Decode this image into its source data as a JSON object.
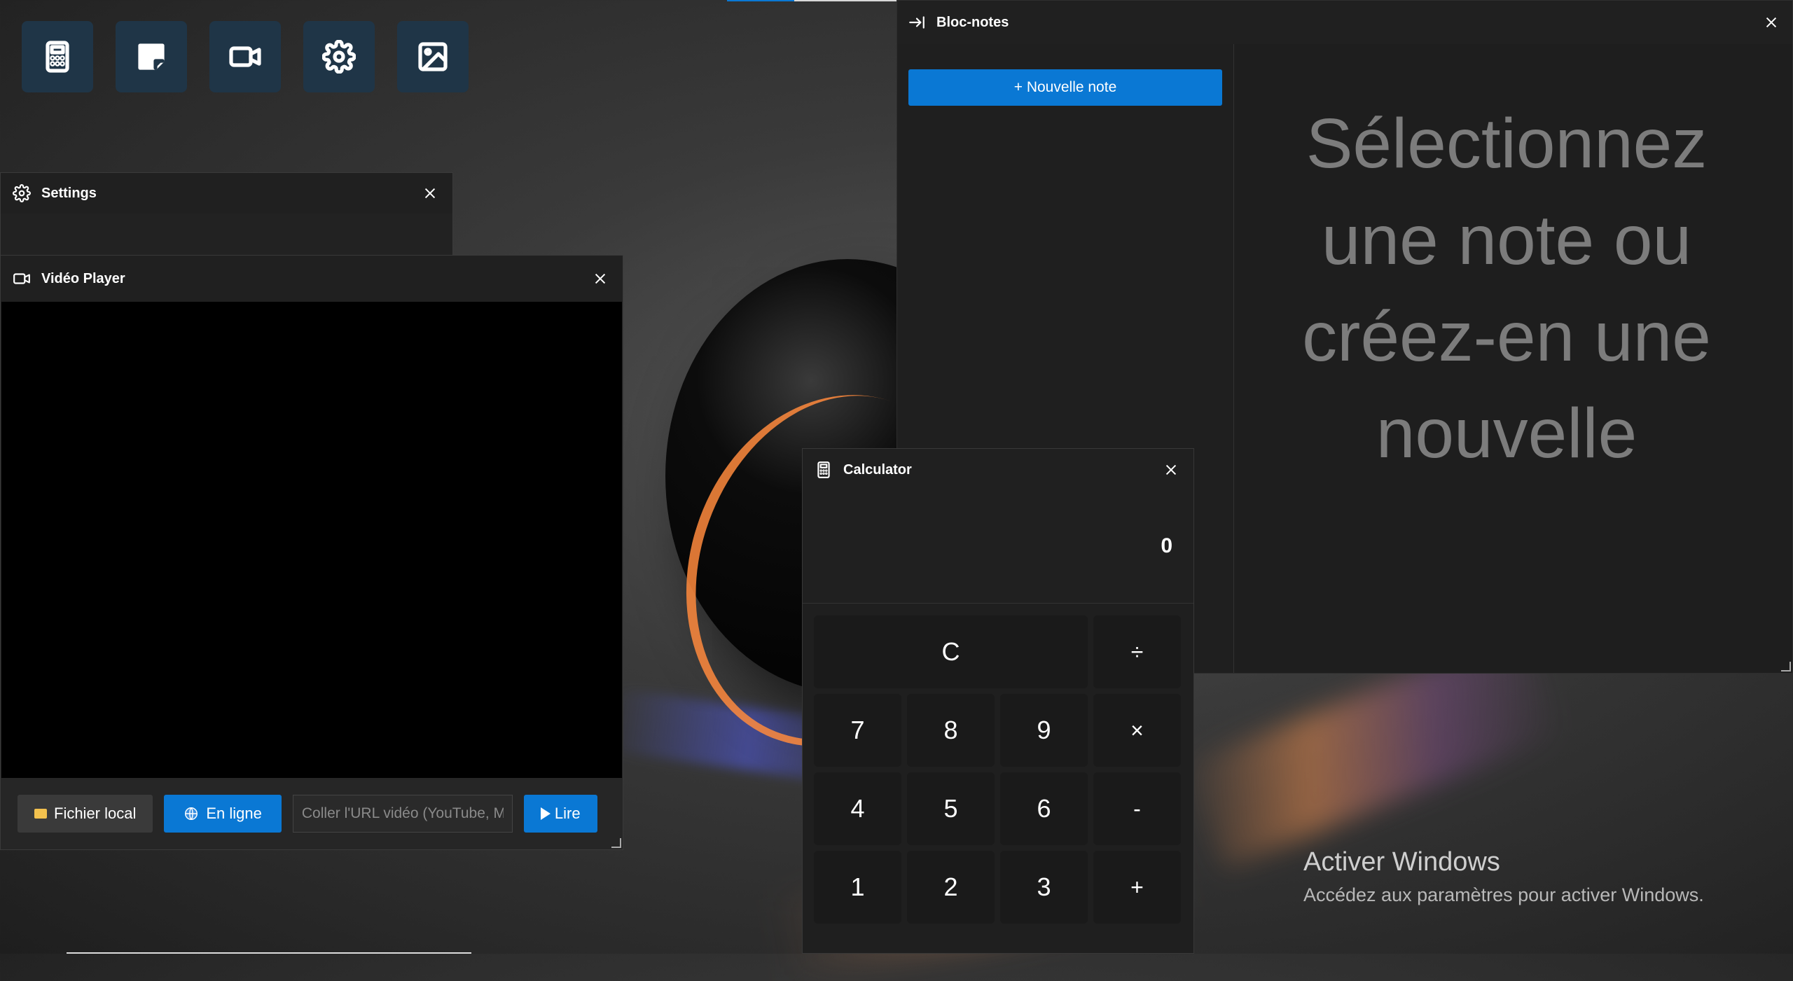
{
  "dock": {
    "items": [
      {
        "name": "calculator",
        "icon": "calculator-icon"
      },
      {
        "name": "notes",
        "icon": "sticky-note-icon"
      },
      {
        "name": "video",
        "icon": "video-camera-icon"
      },
      {
        "name": "settings",
        "icon": "gear-icon"
      },
      {
        "name": "gallery",
        "icon": "image-icon"
      }
    ]
  },
  "settings_window": {
    "title": "Settings"
  },
  "video_window": {
    "title": "Vidéo Player",
    "local_file_label": "Fichier local",
    "online_label": "En ligne",
    "url_placeholder": "Coller l'URL vidéo (YouTube, M",
    "play_label": "Lire"
  },
  "notepad_window": {
    "title": "Bloc-notes",
    "new_note_label": "+ Nouvelle note",
    "empty_message": "Sélectionnez une note ou créez-en une nouvelle"
  },
  "calculator_window": {
    "title": "Calculator",
    "display": "0",
    "keys": [
      "C",
      "÷",
      "7",
      "8",
      "9",
      "×",
      "4",
      "5",
      "6",
      "-",
      "1",
      "2",
      "3",
      "+"
    ]
  },
  "watermark": {
    "line1": "Activer Windows",
    "line2": "Accédez aux paramètres pour activer Windows."
  },
  "colors": {
    "accent": "#0a78d4",
    "dock_bg": "#1f3547",
    "window_bg": "#202020"
  }
}
